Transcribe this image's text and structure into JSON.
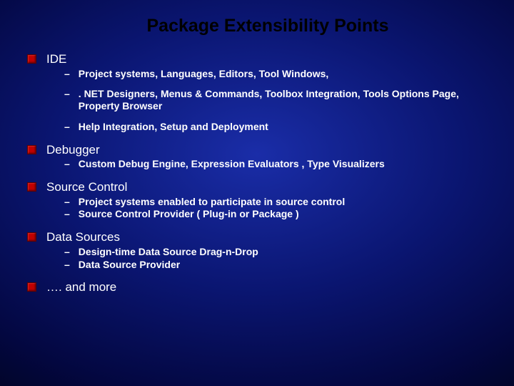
{
  "title": "Package Extensibility Points",
  "sections": [
    {
      "label": "IDE",
      "items": [
        "Project systems, Languages, Editors, Tool Windows,",
        ". NET Designers, Menus & Commands, Toolbox Integration, Tools Options Page, Property Browser",
        "Help Integration, Setup and Deployment"
      ],
      "spaced": true
    },
    {
      "label": "Debugger",
      "items": [
        "Custom Debug Engine, Expression Evaluators , Type Visualizers"
      ],
      "spaced": false
    },
    {
      "label": "Source Control",
      "items": [
        "Project systems enabled to participate in source control",
        "Source Control Provider ( Plug-in or Package )"
      ],
      "spaced": false
    },
    {
      "label": "Data Sources",
      "items": [
        "Design-time Data Source Drag-n-Drop",
        "Data Source Provider"
      ],
      "spaced": false
    },
    {
      "label": "…. and more",
      "items": [],
      "spaced": false
    }
  ]
}
